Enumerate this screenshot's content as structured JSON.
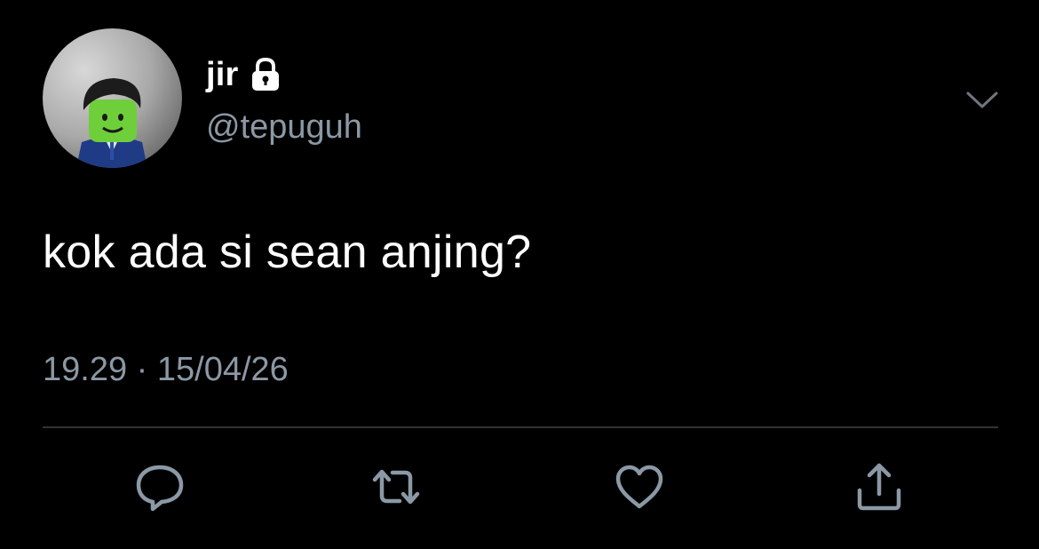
{
  "author": {
    "display_name": "jir",
    "handle": "@tepuguh",
    "protected": true
  },
  "tweet": {
    "text": "kok ada si sean anjing?",
    "timestamp": "19.29 · 15/04/26"
  },
  "icons": {
    "lock": "lock-icon",
    "menu": "chevron-down-icon",
    "reply": "reply-icon",
    "retweet": "retweet-icon",
    "like": "heart-icon",
    "share": "share-icon"
  },
  "colors": {
    "background": "#000000",
    "text": "#ffffff",
    "secondary": "#8b98a5",
    "divider": "#2f3336"
  }
}
